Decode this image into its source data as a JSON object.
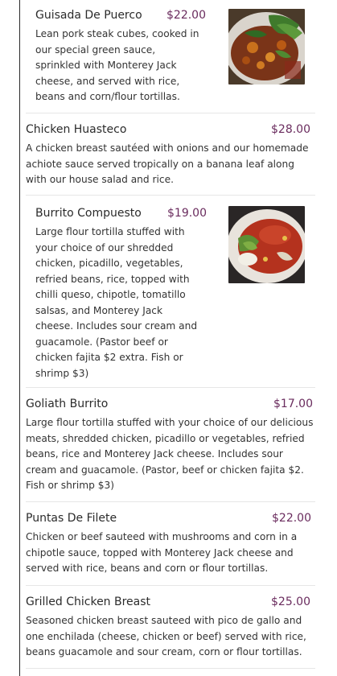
{
  "menu": {
    "items": [
      {
        "name": "Guisada De Puerco",
        "price": "$22.00",
        "description": "Lean pork steak cubes, cooked in our special green sauce, sprinkled with Monterey Jack cheese, and served with rice, beans and corn/flour tortillas."
      },
      {
        "name": "Chicken Huasteco",
        "price": "$28.00",
        "description": "A chicken breast sautéed with onions and our homemade achiote sauce served tropically on a banana leaf along with our house salad and rice."
      },
      {
        "name": "Burrito Compuesto",
        "price": "$19.00",
        "description": "Large flour tortilla stuffed with your choice of our shredded chicken, picadillo, vegetables, refried beans, rice, topped with chilli queso, chipotle, tomatillo salsas, and Monterey Jack cheese. Includes sour cream and guacamole. (Pastor beef or chicken fajita $2 extra. Fish or shrimp $3)"
      },
      {
        "name": "Goliath Burrito",
        "price": "$17.00",
        "description": "Large flour tortilla stuffed with your choice of our delicious meats, shredded chicken, picadillo or vegetables, refried beans, rice and Monterey Jack cheese. Includes sour cream and guacamole. (Pastor, beef or chicken fajita $2. Fish or shrimp $3)"
      },
      {
        "name": "Puntas De Filete",
        "price": "$22.00",
        "description": "Chicken or beef sauteed with mushrooms and corn in a chipotle sauce, topped with Monterey Jack cheese and served with rice, beans and corn or flour tortillas."
      },
      {
        "name": "Grilled Chicken Breast",
        "price": "$25.00",
        "description": "Seasoned chicken breast sauteed with pico de gallo and one enchilada (cheese, chicken or beef) served with rice, beans guacamole and sour cream, corn or flour tortillas."
      }
    ]
  },
  "colors": {
    "price": "#6a2c5e",
    "text": "#333333",
    "divider": "#e6e6e6"
  }
}
